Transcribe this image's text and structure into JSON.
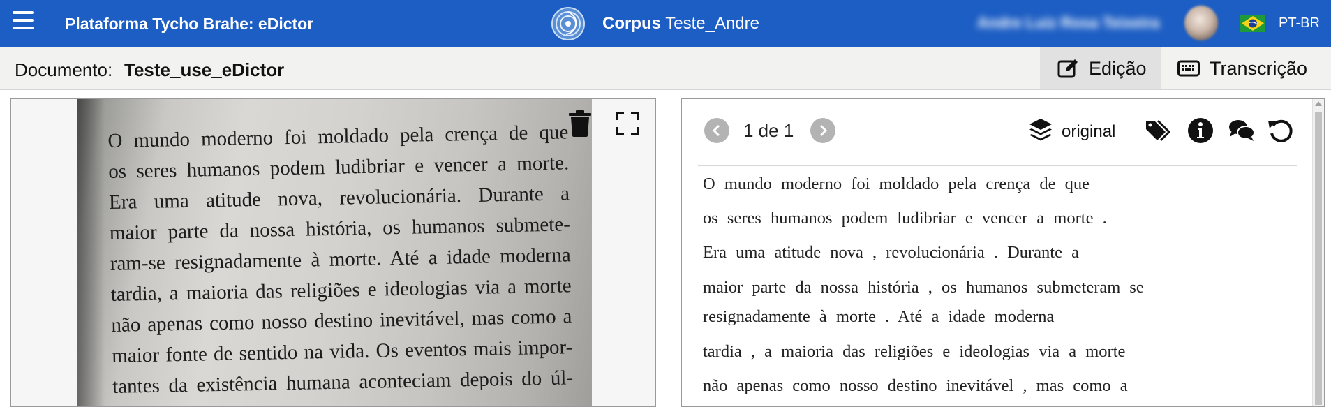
{
  "header": {
    "app_title": "Plataforma Tycho Brahe: eDictor",
    "corpus_label": "Corpus",
    "corpus_name": "Teste_Andre",
    "user_name": "Andre Luiz Rosa Teixeira",
    "language": "PT-BR"
  },
  "document_bar": {
    "label": "Documento:",
    "name": "Teste_use_eDictor",
    "tabs": [
      {
        "label": "Edição",
        "icon": "edit-icon",
        "active": true
      },
      {
        "label": "Transcrição",
        "icon": "keyboard-icon",
        "active": false
      }
    ]
  },
  "image_panel": {
    "scan_lines": [
      "O mundo moderno foi moldado pela crença de que",
      "os seres humanos podem ludibriar e vencer a morte.",
      "Era uma atitude nova, revolucionária. Durante a",
      "maior parte da nossa história, os humanos submete-",
      "ram-se resignadamente à morte. Até a idade moderna",
      "tardia, a maioria das religiões e ideologias via a morte",
      "não apenas como nosso destino inevitável, mas como a",
      "maior fonte de sentido na vida. Os eventos mais impor-",
      "tantes da existência humana aconteciam depois do úl-"
    ]
  },
  "transcription_panel": {
    "page_counter": "1 de 1",
    "layer": "original",
    "lines": [
      "O mundo moderno foi moldado pela crença de que",
      "os seres humanos podem ludibriar e vencer a morte .",
      "Era uma atitude nova , revolucionária . Durante a",
      "maior parte da nossa história , os humanos submeteram se",
      "resignadamente à morte . Até a idade moderna",
      "tardia , a maioria das religiões e ideologias via a morte",
      "não apenas como nosso destino inevitável , mas como a"
    ]
  },
  "colors": {
    "header_bg": "#1d5ec4",
    "doc_bar_bg": "#f2f2f0",
    "active_tab_bg": "#e1e1e1"
  }
}
